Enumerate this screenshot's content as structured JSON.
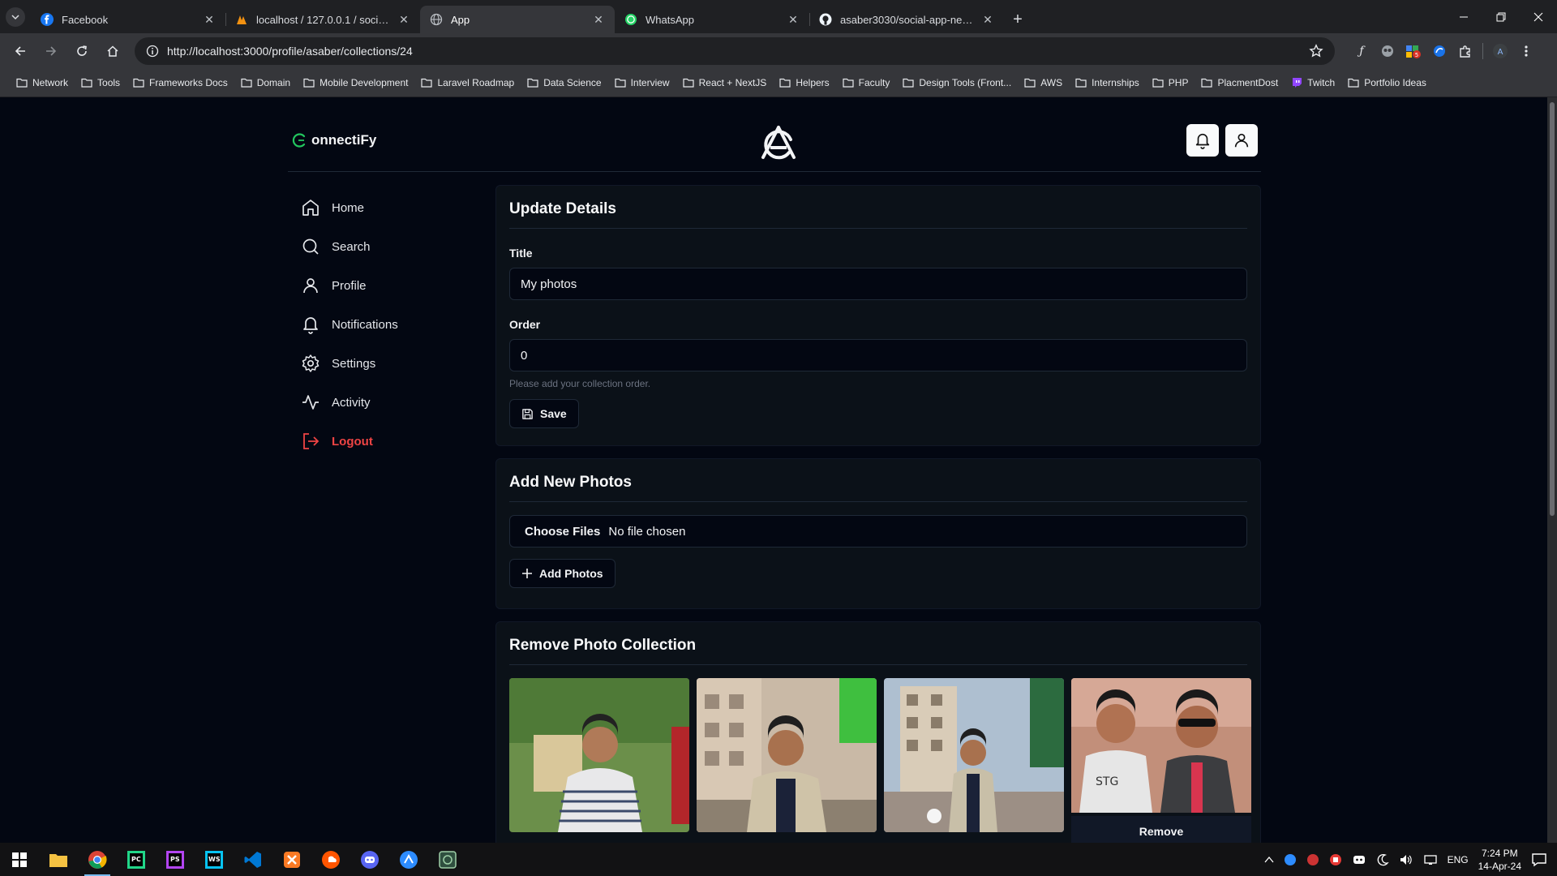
{
  "browser": {
    "tabs": [
      {
        "title": "Facebook",
        "icon": "facebook-icon"
      },
      {
        "title": "localhost / 127.0.0.1 / social-media",
        "icon": "phpmyadmin-icon"
      },
      {
        "title": "App",
        "icon": "globe-icon",
        "active": true
      },
      {
        "title": "WhatsApp",
        "icon": "whatsapp-icon"
      },
      {
        "title": "asaber3030/social-app-nextjs",
        "icon": "github-icon"
      }
    ],
    "url": "http://localhost:3000/profile/asaber/collections/24",
    "bookmarks": [
      "Network",
      "Tools",
      "Frameworks Docs",
      "Domain",
      "Mobile Development",
      "Laravel Roadmap",
      "Data Science",
      "Interview",
      "React + NextJS",
      "Helpers",
      "Faculty",
      "Design Tools (Front...",
      "AWS",
      "Internships",
      "PHP",
      "PlacmentDost",
      "Twitch",
      "Portfolio Ideas"
    ]
  },
  "app": {
    "brand": "onnectiFy",
    "nav": [
      {
        "label": "Home",
        "icon": "home-icon"
      },
      {
        "label": "Search",
        "icon": "search-icon"
      },
      {
        "label": "Profile",
        "icon": "user-icon"
      },
      {
        "label": "Notifications",
        "icon": "bell-icon"
      },
      {
        "label": "Settings",
        "icon": "gear-icon"
      },
      {
        "label": "Activity",
        "icon": "activity-icon"
      },
      {
        "label": "Logout",
        "icon": "logout-icon"
      }
    ],
    "update": {
      "heading": "Update Details",
      "title_label": "Title",
      "title_value": "My photos",
      "order_label": "Order",
      "order_value": "0",
      "order_hint": "Please add your collection order.",
      "save_label": "Save"
    },
    "add": {
      "heading": "Add New Photos",
      "choose_label": "Choose Files",
      "no_file": "No file chosen",
      "add_label": "Add Photos"
    },
    "remove": {
      "heading": "Remove Photo Collection",
      "remove_label": "Remove"
    }
  },
  "taskbar": {
    "lang": "ENG",
    "time": "7:24 PM",
    "date": "14-Apr-24"
  },
  "colors": {
    "accent_green": "#22c55e",
    "logout_red": "#ef4444",
    "page_bg": "#030712"
  }
}
